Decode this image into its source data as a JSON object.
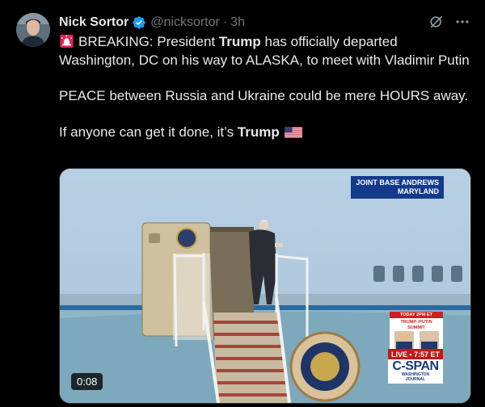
{
  "post": {
    "author_name": "Nick Sortor",
    "handle": "@nicksortor",
    "separator": "·",
    "time": "3h",
    "lines": [
      {
        "pre": "BREAKING: President ",
        "bold": "Trump",
        "post": " has officially departed Washington, DC on his way to ALASKA, to meet with Vladimir Putin"
      },
      {
        "text": "PEACE between Russia and Ukraine could be mere HOURS away."
      },
      {
        "pre": "If anyone can get it done, it’s ",
        "bold": "Trump"
      }
    ]
  },
  "video": {
    "duration": "0:08",
    "location_line1": "JOINT BASE ANDREWS",
    "location_line2": "MARYLAND",
    "summit_header": "TODAY 2PM ET",
    "summit_title_1": "TRUMP–PUTIN",
    "summit_title_2": "SUMMIT",
    "live_label": "LIVE",
    "live_dot": "▪",
    "live_time": "7:57",
    "live_zone": "ET",
    "network": "C-SPAN",
    "network_sub_1": "WASHINGTON",
    "network_sub_2": "JOURNAL"
  },
  "icons": {
    "verified": "verified-badge-icon",
    "grok": "grok-icon",
    "more": "more-icon",
    "siren": "rotating-light-icon",
    "flag": "us-flag-icon"
  },
  "colors": {
    "background": "#000000",
    "text": "#e7e9ea",
    "muted": "#71767b",
    "verified": "#1d9bf0",
    "location_badge": "#143a8c",
    "live_red": "#c21818"
  }
}
